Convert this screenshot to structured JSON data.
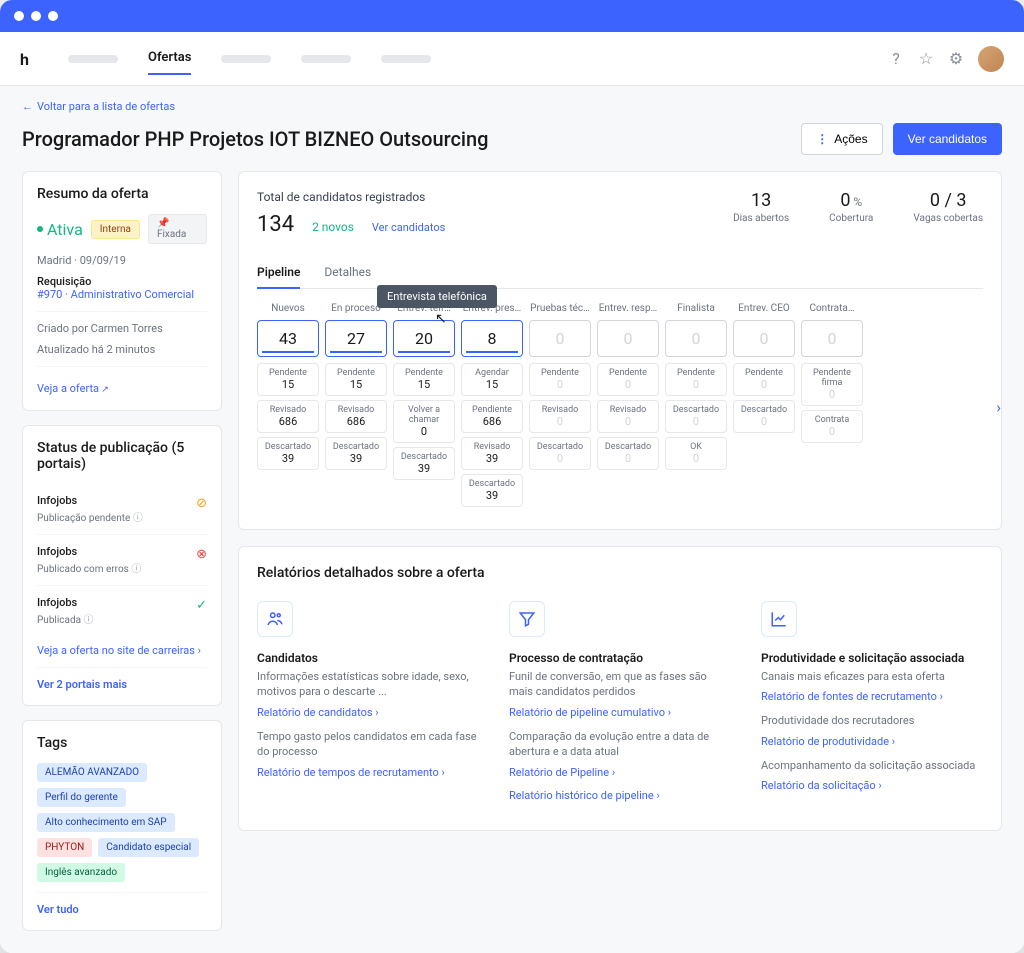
{
  "topnav": {
    "active_tab": "Ofertas"
  },
  "breadcrumb": "Voltar para a lista de ofertas",
  "page_title": "Programador PHP Projetos IOT BIZNEO Outsourcing",
  "actions": {
    "acoes": "Ações",
    "ver_candidatos": "Ver candidatos"
  },
  "summary": {
    "title": "Resumo da oferta",
    "status": "Ativa",
    "badge_interna": "Interna",
    "badge_fixada": "Fixada",
    "location_date": "Madrid · 09/09/19",
    "requisicao_label": "Requisição",
    "requisicao_link": "#970 · Administrativo Comercial",
    "created_by": "Criado por Carmen Torres",
    "updated": "Atualizado há 2 minutos",
    "view_link": "Veja a oferta"
  },
  "publication": {
    "title": "Status de publicação (5 portais)",
    "portals": [
      {
        "name": "Infojobs",
        "status": "Publicação pendente",
        "icon": "warn"
      },
      {
        "name": "Infojobs",
        "status": "Publicado com erros",
        "icon": "err"
      },
      {
        "name": "Infojobs",
        "status": "Publicada",
        "icon": "ok"
      }
    ],
    "careers_link": "Veja a oferta no site de carreiras",
    "more_link": "Ver 2 portais mais"
  },
  "tags": {
    "title": "Tags",
    "items": [
      {
        "label": "ALEMÃO AVANZADO",
        "cls": ""
      },
      {
        "label": "Perfil do gerente",
        "cls": ""
      },
      {
        "label": "Alto conhecimento em SAP",
        "cls": ""
      },
      {
        "label": "PHYTON",
        "cls": "red"
      },
      {
        "label": "Candidato especial",
        "cls": ""
      },
      {
        "label": "Inglês avanzado",
        "cls": "green"
      }
    ],
    "more": "Ver tudo"
  },
  "stats": {
    "label": "Total de candidatos registrados",
    "total": "134",
    "new": "2 novos",
    "link": "Ver candidatos",
    "kpis": [
      {
        "num": "13",
        "suffix": "",
        "lbl": "Dias abertos"
      },
      {
        "num": "0",
        "suffix": " %",
        "lbl": "Cobertura"
      },
      {
        "num": "0 / 3",
        "suffix": "",
        "lbl": "Vagas cobertas"
      }
    ]
  },
  "tabs": {
    "pipeline": "Pipeline",
    "detalhes": "Detalhes",
    "tooltip": "Entrevista telefônica"
  },
  "pipeline": [
    {
      "name": "Nuevos",
      "count": "43",
      "filled": true,
      "subs": [
        {
          "l": "Pendente",
          "n": "15"
        },
        {
          "l": "Revisado",
          "n": "686"
        },
        {
          "l": "Descartado",
          "n": "39"
        }
      ]
    },
    {
      "name": "En proceso",
      "count": "27",
      "filled": true,
      "subs": [
        {
          "l": "Pendente",
          "n": "15"
        },
        {
          "l": "Revisado",
          "n": "686"
        },
        {
          "l": "Descartado",
          "n": "39"
        }
      ]
    },
    {
      "name": "Entrev. telf…",
      "count": "20",
      "filled": true,
      "subs": [
        {
          "l": "Pendente",
          "n": "15"
        },
        {
          "l": "Volver a chamar",
          "n": "0"
        },
        {
          "l": "Descartado",
          "n": "39"
        }
      ]
    },
    {
      "name": "Entrev. pres…",
      "count": "8",
      "filled": true,
      "subs": [
        {
          "l": "Agendar",
          "n": "15"
        },
        {
          "l": "Pendiente",
          "n": "686"
        },
        {
          "l": "Revisado",
          "n": "39"
        },
        {
          "l": "Descartado",
          "n": "39"
        }
      ]
    },
    {
      "name": "Pruebas téc…",
      "count": "0",
      "filled": false,
      "subs": [
        {
          "l": "Pendente",
          "n": "0",
          "dim": true
        },
        {
          "l": "Revisado",
          "n": "0",
          "dim": true
        },
        {
          "l": "Descartado",
          "n": "0",
          "dim": true
        }
      ]
    },
    {
      "name": "Entrev. resp…",
      "count": "0",
      "filled": false,
      "subs": [
        {
          "l": "Pendente",
          "n": "0",
          "dim": true
        },
        {
          "l": "Revisado",
          "n": "0",
          "dim": true
        },
        {
          "l": "Descartado",
          "n": "0",
          "dim": true
        }
      ]
    },
    {
      "name": "Finalista",
      "count": "0",
      "filled": false,
      "subs": [
        {
          "l": "Pendente",
          "n": "0",
          "dim": true
        },
        {
          "l": "Descartado",
          "n": "0",
          "dim": true
        },
        {
          "l": "OK",
          "n": "0",
          "dim": true
        }
      ]
    },
    {
      "name": "Entrev. CEO",
      "count": "0",
      "filled": false,
      "subs": [
        {
          "l": "Pendente",
          "n": "0",
          "dim": true
        },
        {
          "l": "Descartado",
          "n": "0",
          "dim": true
        }
      ]
    },
    {
      "name": "Contrata…",
      "count": "0",
      "filled": false,
      "subs": [
        {
          "l": "Pendente firma",
          "n": "0",
          "dim": true
        },
        {
          "l": "Contrata",
          "n": "0",
          "dim": true
        }
      ]
    }
  ],
  "reports": {
    "title": "Relatórios detalhados sobre a oferta",
    "cols": [
      {
        "icon": "people",
        "title": "Candidatos",
        "blocks": [
          {
            "desc": "Informações estatísticas sobre idade, sexo, motivos para o descarte ...",
            "link": "Relatório de candidatos"
          },
          {
            "desc": "Tempo gasto pelos candidatos em cada fase do processo",
            "link": "Relatório de tempos de recrutamento"
          }
        ]
      },
      {
        "icon": "funnel",
        "title": "Processo de contratação",
        "blocks": [
          {
            "desc": "Funil de conversão, em que as fases são mais candidatos perdidos",
            "link": "Relatório de pipeline cumulativo"
          },
          {
            "desc": "Comparação da evolução entre a data de abertura e a data atual",
            "link": "Relatório de Pipeline"
          },
          {
            "desc": "",
            "link": "Relatório histórico de pipeline"
          }
        ]
      },
      {
        "icon": "chart",
        "title": "Produtividade e solicitação associada",
        "blocks": [
          {
            "desc": "Canais mais eficazes para esta oferta",
            "link": "Relatório de fontes de recrutamento"
          },
          {
            "desc": "Produtividade dos recrutadores",
            "link": "Relatório de produtividade"
          },
          {
            "desc": "Acompanhamento da solicitação associada",
            "link": "Relatório da solicitação"
          }
        ]
      }
    ]
  }
}
